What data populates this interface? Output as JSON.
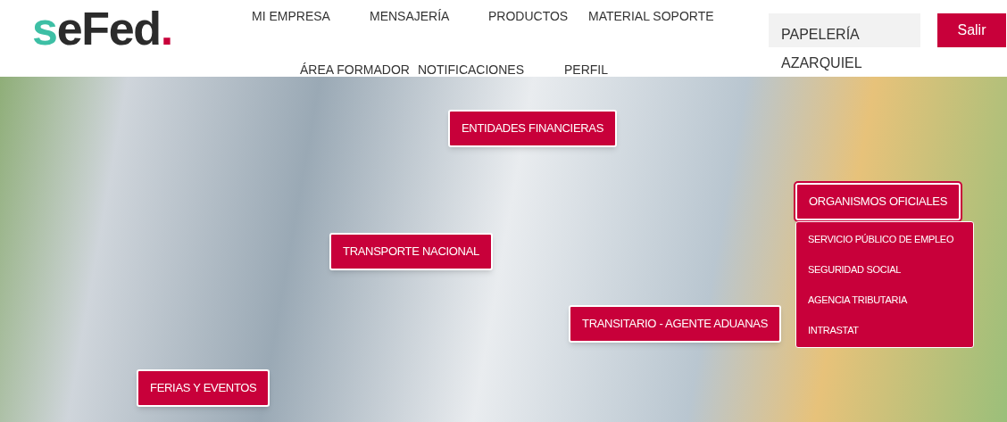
{
  "logo": {
    "parts": [
      {
        "text": "s",
        "color": "#3dbfa5"
      },
      {
        "text": "eFed",
        "color": "#2b2b2b"
      },
      {
        "text": ".",
        "color": "#c8003a"
      }
    ]
  },
  "nav": {
    "row_1": [
      "MI EMPRESA",
      "MENSAJERÍA",
      "PRODUCTOS",
      "MATERIAL SOPORTE"
    ],
    "row_2": [
      "ÁREA FORMADOR",
      "NOTIFICACIONES",
      "PERFIL"
    ]
  },
  "company": "PAPELERÍA AZARQUIEL",
  "logout_button": "Salir",
  "hotspots": [
    {
      "label": "ENTIDADES FINANCIERAS",
      "expanded": false
    },
    {
      "label": "TRANSPORTE NACIONAL",
      "expanded": false
    },
    {
      "label": "ORGANISMOS OFICIALES",
      "expanded": true,
      "children": [
        "SERVICIO PÚBLICO DE EMPLEO",
        "SEGURIDAD SOCIAL",
        "AGENCIA TRIBUTARIA",
        "INTRASTAT"
      ]
    },
    {
      "label": "TRANSITARIO - AGENTE ADUANAS",
      "expanded": false
    },
    {
      "label": "FERIAS Y EVENTOS",
      "expanded": false
    }
  ]
}
